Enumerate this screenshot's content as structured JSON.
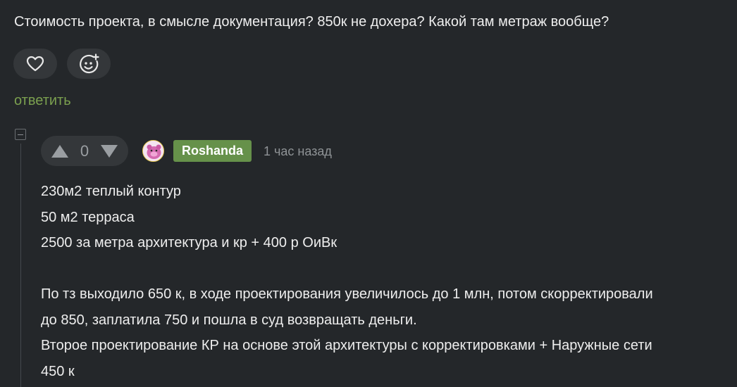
{
  "parent_comment": {
    "text": "Стоимость проекта, в смысле документация? 850к не дохера? Какой там метраж вообще?",
    "actions": {
      "like_icon": "heart-icon",
      "reaction_icon": "smiley-plus-icon"
    },
    "reply_label": "ответить"
  },
  "reply_comment": {
    "vote": {
      "count": "0",
      "up_icon": "triangle-up-icon",
      "down_icon": "triangle-down-icon"
    },
    "author": {
      "username": "Roshanda",
      "avatar_icon": "avatar-image"
    },
    "time_ago": "1 час назад",
    "body": {
      "line1": "230м2 теплый контур",
      "line2": "50 м2 терраса",
      "line3": "2500 за метра архитектура и кр + 400 р ОиВк",
      "line4": "По тз выходило 650 к, в ходе проектирования увеличилось до 1 млн, потом скорректировали",
      "line5": "до 850, заплатила 750 и пошла в суд возвращать деньги.",
      "line6": "Второе проектирование КР на основе этой архитектуры с корректировками + Наружные сети",
      "line7": "450 к"
    }
  },
  "colors": {
    "background": "#24272a",
    "button_bg": "#34373a",
    "accent_green": "#7ba04f",
    "username_badge": "#66914a",
    "muted_text": "#8f9396"
  }
}
